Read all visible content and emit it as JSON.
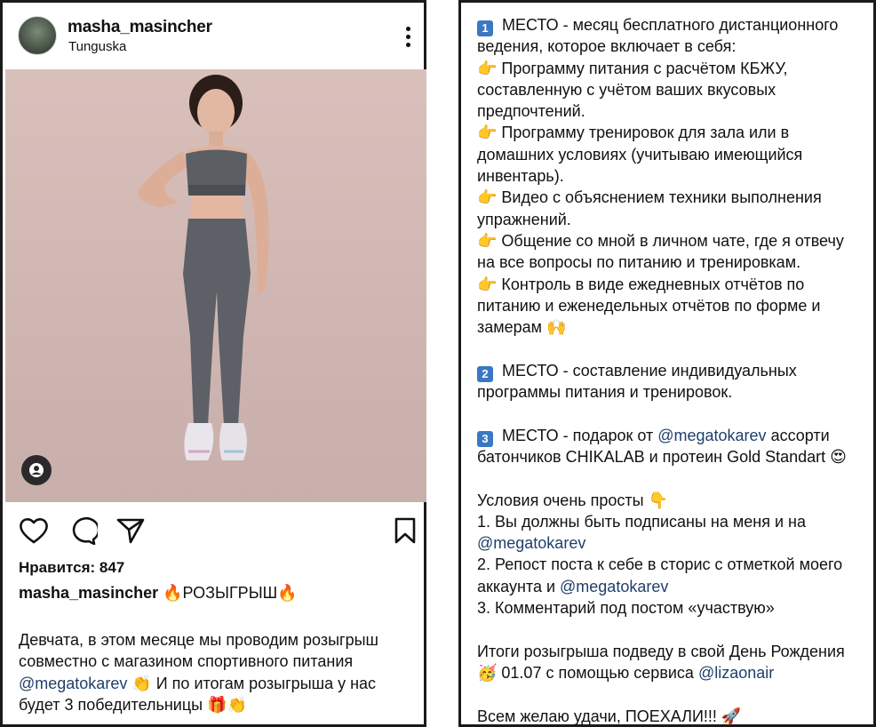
{
  "post": {
    "username": "masha_masincher",
    "location": "Tunguska",
    "likes": "Нравится: 847",
    "caption_title": "🔥РОЗЫГРЫШ🔥",
    "caption_lines": [
      {
        "pre": "Девчата, в этом месяце мы проводим розыгрыш",
        "mention": "",
        "post": ""
      },
      {
        "pre": "совместно с магазином спортивного питания",
        "mention": "",
        "post": ""
      },
      {
        "pre": "",
        "mention": "@megatokarev",
        "post": " 👏 И по итогам розыгрыша у нас"
      },
      {
        "pre": "будет 3 победительницы 🎁👏",
        "mention": "",
        "post": ""
      }
    ]
  },
  "right": {
    "lines": [
      {
        "num": "1",
        "pre": " МЕСТО - месяц бесплатного дистанционного",
        "mention": "",
        "post": ""
      },
      {
        "num": "",
        "pre": "ведения, которое включает в себя:",
        "mention": "",
        "post": ""
      },
      {
        "num": "",
        "pre": "👉 Программу питания с расчётом КБЖУ,",
        "mention": "",
        "post": ""
      },
      {
        "num": "",
        "pre": "составленную с учётом ваших вкусовых",
        "mention": "",
        "post": ""
      },
      {
        "num": "",
        "pre": "предпочтений.",
        "mention": "",
        "post": ""
      },
      {
        "num": "",
        "pre": "👉 Программу тренировок для зала или в",
        "mention": "",
        "post": ""
      },
      {
        "num": "",
        "pre": "домашних условиях (учитываю имеющийся",
        "mention": "",
        "post": ""
      },
      {
        "num": "",
        "pre": "инвентарь).",
        "mention": "",
        "post": ""
      },
      {
        "num": "",
        "pre": "👉 Видео с объяснением техники выполнения",
        "mention": "",
        "post": ""
      },
      {
        "num": "",
        "pre": "упражнений.",
        "mention": "",
        "post": ""
      },
      {
        "num": "",
        "pre": "👉 Общение со мной в личном чате, где я отвечу",
        "mention": "",
        "post": ""
      },
      {
        "num": "",
        "pre": "на все вопросы по питанию и тренировкам.",
        "mention": "",
        "post": ""
      },
      {
        "num": "",
        "pre": "👉 Контроль в виде ежедневных отчётов по",
        "mention": "",
        "post": ""
      },
      {
        "num": "",
        "pre": "питанию и еженедельных отчётов по форме и",
        "mention": "",
        "post": ""
      },
      {
        "num": "",
        "pre": "замерам 🙌",
        "mention": "",
        "post": ""
      },
      {
        "num": "",
        "pre": "",
        "mention": "",
        "post": ""
      },
      {
        "num": "2",
        "pre": " МЕСТО - составление индивидуальных",
        "mention": "",
        "post": ""
      },
      {
        "num": "",
        "pre": "программы питания и тренировок.",
        "mention": "",
        "post": ""
      },
      {
        "num": "",
        "pre": "",
        "mention": "",
        "post": ""
      },
      {
        "num": "3",
        "pre": " МЕСТО - подарок от ",
        "mention": "@megatokarev",
        "post": " ассорти"
      },
      {
        "num": "",
        "pre": "батончиков CHIKALAB и протеин Gold Standart 😍",
        "mention": "",
        "post": ""
      },
      {
        "num": "",
        "pre": "",
        "mention": "",
        "post": ""
      },
      {
        "num": "",
        "pre": "Условия очень просты 👇",
        "mention": "",
        "post": ""
      },
      {
        "num": "",
        "pre": "1. Вы должны быть подписаны  на меня и на",
        "mention": "",
        "post": ""
      },
      {
        "num": "",
        "pre": "",
        "mention": "@megatokarev",
        "post": ""
      },
      {
        "num": "",
        "pre": "2. Репост поста к себе в сторис с отметкой моего",
        "mention": "",
        "post": ""
      },
      {
        "num": "",
        "pre": "аккаунта и ",
        "mention": "@megatokarev",
        "post": ""
      },
      {
        "num": "",
        "pre": "3. Комментарий под постом «участвую»",
        "mention": "",
        "post": ""
      },
      {
        "num": "",
        "pre": "",
        "mention": "",
        "post": ""
      },
      {
        "num": "",
        "pre": "Итоги розыгрыша подведу в свой День Рождения",
        "mention": "",
        "post": ""
      },
      {
        "num": "",
        "pre": "🥳 01.07 с помощью сервиса ",
        "mention": "@lizaonair",
        "post": ""
      },
      {
        "num": "",
        "pre": "",
        "mention": "",
        "post": ""
      },
      {
        "num": "",
        "pre": "Всем желаю удачи, ПОЕХАЛИ!!! 🚀",
        "mention": "",
        "post": ""
      }
    ]
  },
  "icons": {
    "heart": "heart-icon",
    "comment": "comment-icon",
    "share": "share-icon",
    "bookmark": "bookmark-icon",
    "more": "more-icon",
    "user_tag": "user-tag-icon"
  },
  "colors": {
    "mention": "#1f3f6b",
    "number_badge": "#3b78c4",
    "photo_bg": "#d2b8b4"
  }
}
